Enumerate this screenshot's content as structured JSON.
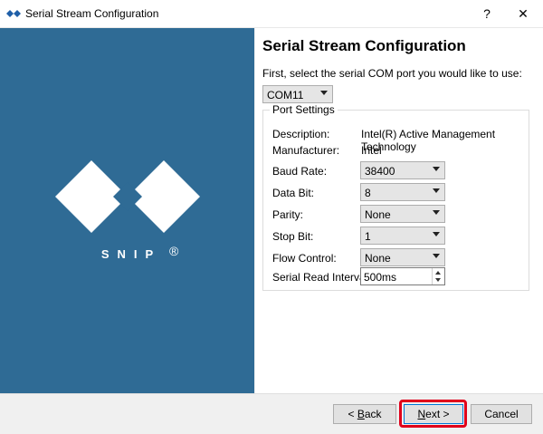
{
  "window": {
    "title": "Serial Stream Configuration",
    "help_label": "?",
    "close_label": "✕"
  },
  "brand": {
    "logo_text": "SNIP",
    "registered": "®"
  },
  "colors": {
    "side_panel": "#2f6b95",
    "highlight": "#e0001b",
    "focus": "#0078d7"
  },
  "main": {
    "heading": "Serial Stream Configuration",
    "prompt": "First, select the serial COM port you would like to use:",
    "com_port": {
      "value": "COM11"
    }
  },
  "port_settings": {
    "title": "Port Settings",
    "description": {
      "label": "Description:",
      "value": "Intel(R) Active Management Technology"
    },
    "manufacturer": {
      "label": "Manufacturer:",
      "value": "Intel"
    },
    "baud_rate": {
      "label": "Baud Rate:",
      "value": "38400"
    },
    "data_bit": {
      "label": "Data Bit:",
      "value": "8"
    },
    "parity": {
      "label": "Parity:",
      "value": "None"
    },
    "stop_bit": {
      "label": "Stop Bit:",
      "value": "1"
    },
    "flow_control": {
      "label": "Flow Control:",
      "value": "None"
    },
    "read_interval": {
      "label": "Serial Read Interval:",
      "value": "500ms"
    }
  },
  "footer": {
    "back": {
      "pre": "< ",
      "mnemonic": "B",
      "post": "ack"
    },
    "next": {
      "mnemonic": "N",
      "post": "ext >"
    },
    "cancel": "Cancel"
  }
}
